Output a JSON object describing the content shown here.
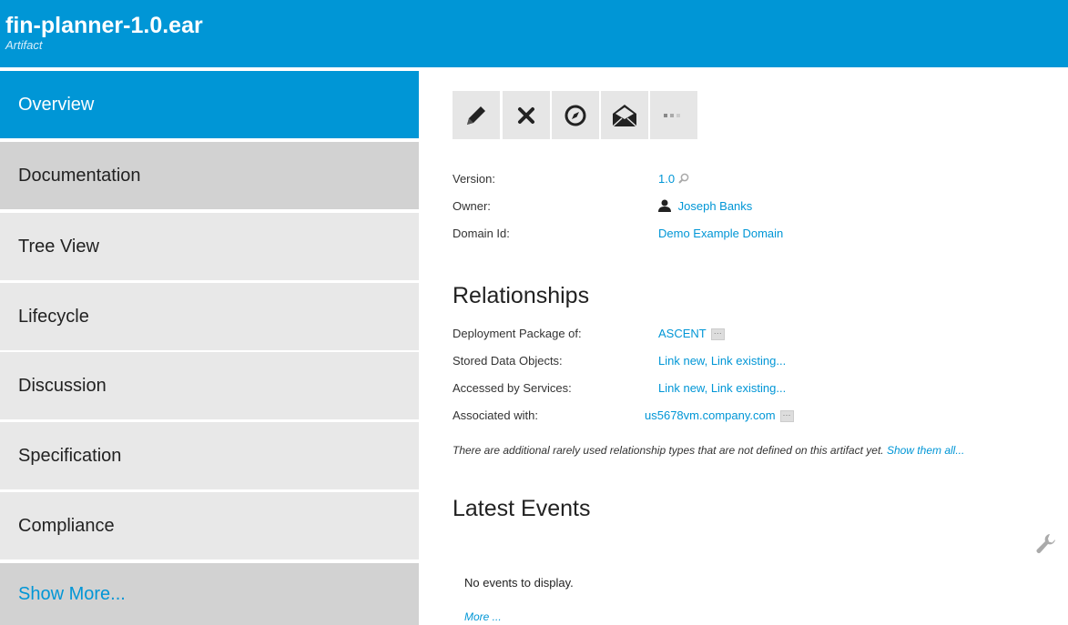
{
  "header": {
    "title": "fin-planner-1.0.ear",
    "subtitle": "Artifact"
  },
  "sidebar": {
    "items": [
      {
        "label": "Overview"
      },
      {
        "label": "Documentation"
      },
      {
        "label": "Tree View"
      },
      {
        "label": "Lifecycle"
      },
      {
        "label": "Discussion"
      },
      {
        "label": "Specification"
      },
      {
        "label": "Compliance"
      },
      {
        "label": "Show More..."
      }
    ]
  },
  "toolbar": {
    "icons": [
      "pencil-icon",
      "close-icon",
      "compass-icon",
      "envelope-icon",
      "more-icon"
    ]
  },
  "properties": {
    "version_label": "Version:",
    "version_value": "1.0",
    "owner_label": "Owner:",
    "owner_value": "Joseph Banks",
    "domain_label": "Domain Id:",
    "domain_value": "Demo Example Domain"
  },
  "relationships": {
    "heading": "Relationships",
    "rows": [
      {
        "label": "Deployment Package of:",
        "value": "ASCENT"
      },
      {
        "label": "Stored Data Objects:",
        "value": "Link new, Link existing..."
      },
      {
        "label": "Accessed by Services:",
        "value": "Link new, Link existing..."
      },
      {
        "label": "Associated with:",
        "value": "us5678vm.company.com"
      }
    ],
    "note": "There are additional rarely used relationship types that are not defined on this artifact yet.",
    "note_link": "Show them all..."
  },
  "events": {
    "heading": "Latest Events",
    "empty_text": "No events to display.",
    "more_link": "More ..."
  },
  "colors": {
    "brand": "#0096d6",
    "nav_bg": "#e8e8e8",
    "nav_alt_bg": "#d2d2d2"
  }
}
